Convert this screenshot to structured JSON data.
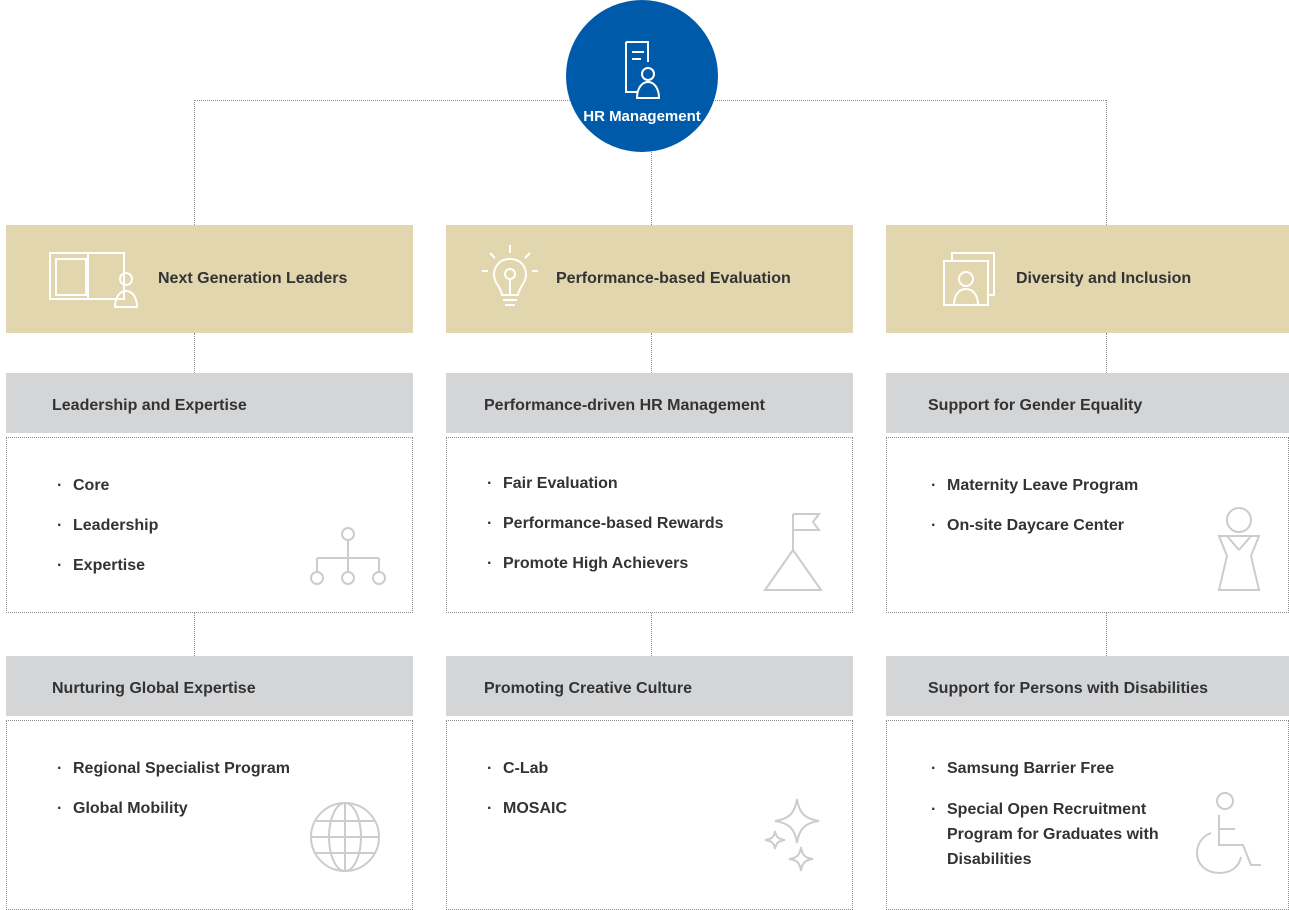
{
  "root": {
    "label": "HR Management",
    "icon": "document-person-icon"
  },
  "columns": [
    {
      "header": "Next Generation Leaders",
      "header_icon": "book-person-icon",
      "sections": [
        {
          "title": "Leadership and Expertise",
          "items": [
            "Core",
            "Leadership",
            "Expertise"
          ],
          "deco_icon": "org-chart-icon"
        },
        {
          "title": "Nurturing Global Expertise",
          "items": [
            "Regional Specialist Program",
            "Global Mobility"
          ],
          "deco_icon": "globe-icon"
        }
      ]
    },
    {
      "header": "Performance-based Evaluation",
      "header_icon": "lightbulb-icon",
      "sections": [
        {
          "title": "Performance-driven HR Management",
          "items": [
            "Fair Evaluation",
            "Performance-based Rewards",
            "Promote High Achievers"
          ],
          "deco_icon": "flag-mountain-icon"
        },
        {
          "title": "Promoting Creative Culture",
          "items": [
            "C-Lab",
            "MOSAIC"
          ],
          "deco_icon": "sparkle-icon"
        }
      ]
    },
    {
      "header": "Diversity and Inclusion",
      "header_icon": "profile-cards-icon",
      "sections": [
        {
          "title": "Support for Gender Equality",
          "items": [
            "Maternity Leave Program",
            "On-site Daycare Center"
          ],
          "deco_icon": "woman-icon"
        },
        {
          "title": "Support for Persons with Disabilities",
          "items": [
            "Samsung Barrier Free",
            "Special Open Recruitment Program for Graduates with Disabilities"
          ],
          "deco_icon": "wheelchair-icon"
        }
      ]
    }
  ],
  "colors": {
    "primary": "#005aaa",
    "header_bg": "#e1d6ae",
    "sub_bg": "#d4d5d7",
    "connector": "#8c8c8c"
  }
}
